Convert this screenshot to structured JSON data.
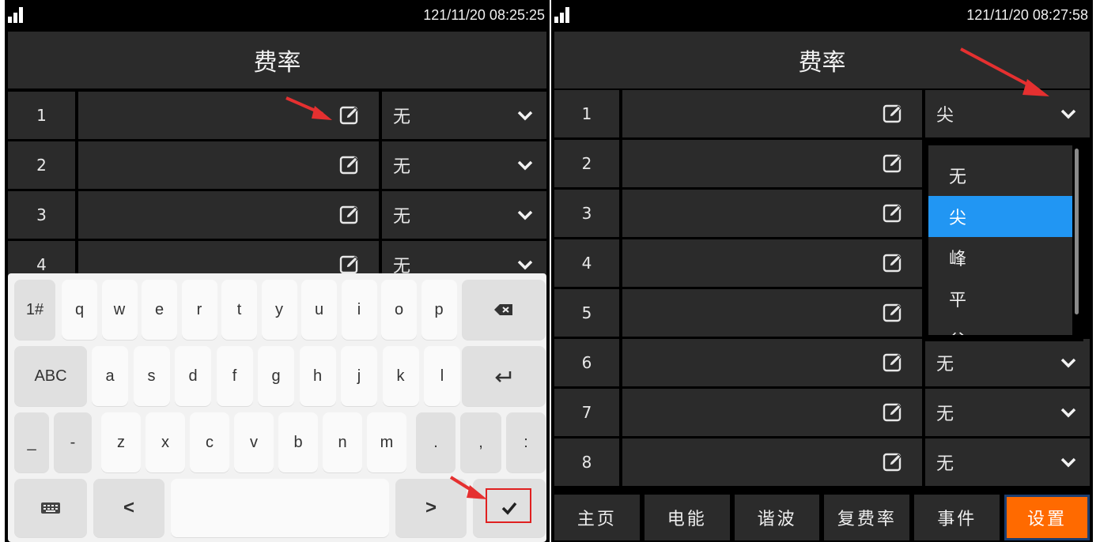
{
  "left": {
    "status_time": "121/11/20 08:25:25",
    "title": "费率",
    "rows": [
      {
        "num": "1",
        "name": "",
        "rate": "无"
      },
      {
        "num": "2",
        "name": "",
        "rate": "无"
      },
      {
        "num": "3",
        "name": "",
        "rate": "无"
      },
      {
        "num": "4",
        "name": "",
        "rate": "无"
      }
    ],
    "keyboard": {
      "row1": [
        "1#",
        "q",
        "w",
        "e",
        "r",
        "t",
        "y",
        "u",
        "i",
        "o",
        "p"
      ],
      "row2": [
        "ABC",
        "a",
        "s",
        "d",
        "f",
        "g",
        "h",
        "j",
        "k",
        "l"
      ],
      "row3": [
        "_",
        "-",
        "z",
        "x",
        "c",
        "v",
        "b",
        "n",
        "m",
        ".",
        ",",
        ":"
      ],
      "row4": [
        "<",
        ">"
      ]
    }
  },
  "right": {
    "status_time": "121/11/20 08:27:58",
    "title": "费率",
    "rows": [
      {
        "num": "1",
        "name": "",
        "rate": "尖"
      },
      {
        "num": "2",
        "name": "",
        "rate": ""
      },
      {
        "num": "3",
        "name": "",
        "rate": ""
      },
      {
        "num": "4",
        "name": "",
        "rate": ""
      },
      {
        "num": "5",
        "name": "",
        "rate": ""
      },
      {
        "num": "6",
        "name": "",
        "rate": "无"
      },
      {
        "num": "7",
        "name": "",
        "rate": "无"
      },
      {
        "num": "8",
        "name": "",
        "rate": "无"
      }
    ],
    "dropdown": {
      "options": [
        "无",
        "尖",
        "峰",
        "平",
        "谷"
      ],
      "selected": "尖"
    },
    "tabs": [
      "主页",
      "电能",
      "谐波",
      "复费率",
      "事件",
      "设置"
    ],
    "active_tab": "设置"
  },
  "colors": {
    "background": "#000000",
    "cell": "#2b2b2b",
    "selected_option": "#2196f3",
    "active_tab": "#ff6a00",
    "annotation_arrow": "#e53030"
  },
  "icons": {
    "edit": "edit-icon",
    "chevron": "chevron-down-icon",
    "signal": "signal-icon",
    "backspace": "backspace-icon",
    "enter": "enter-icon",
    "keyboard": "keyboard-icon",
    "confirm": "check-icon"
  }
}
